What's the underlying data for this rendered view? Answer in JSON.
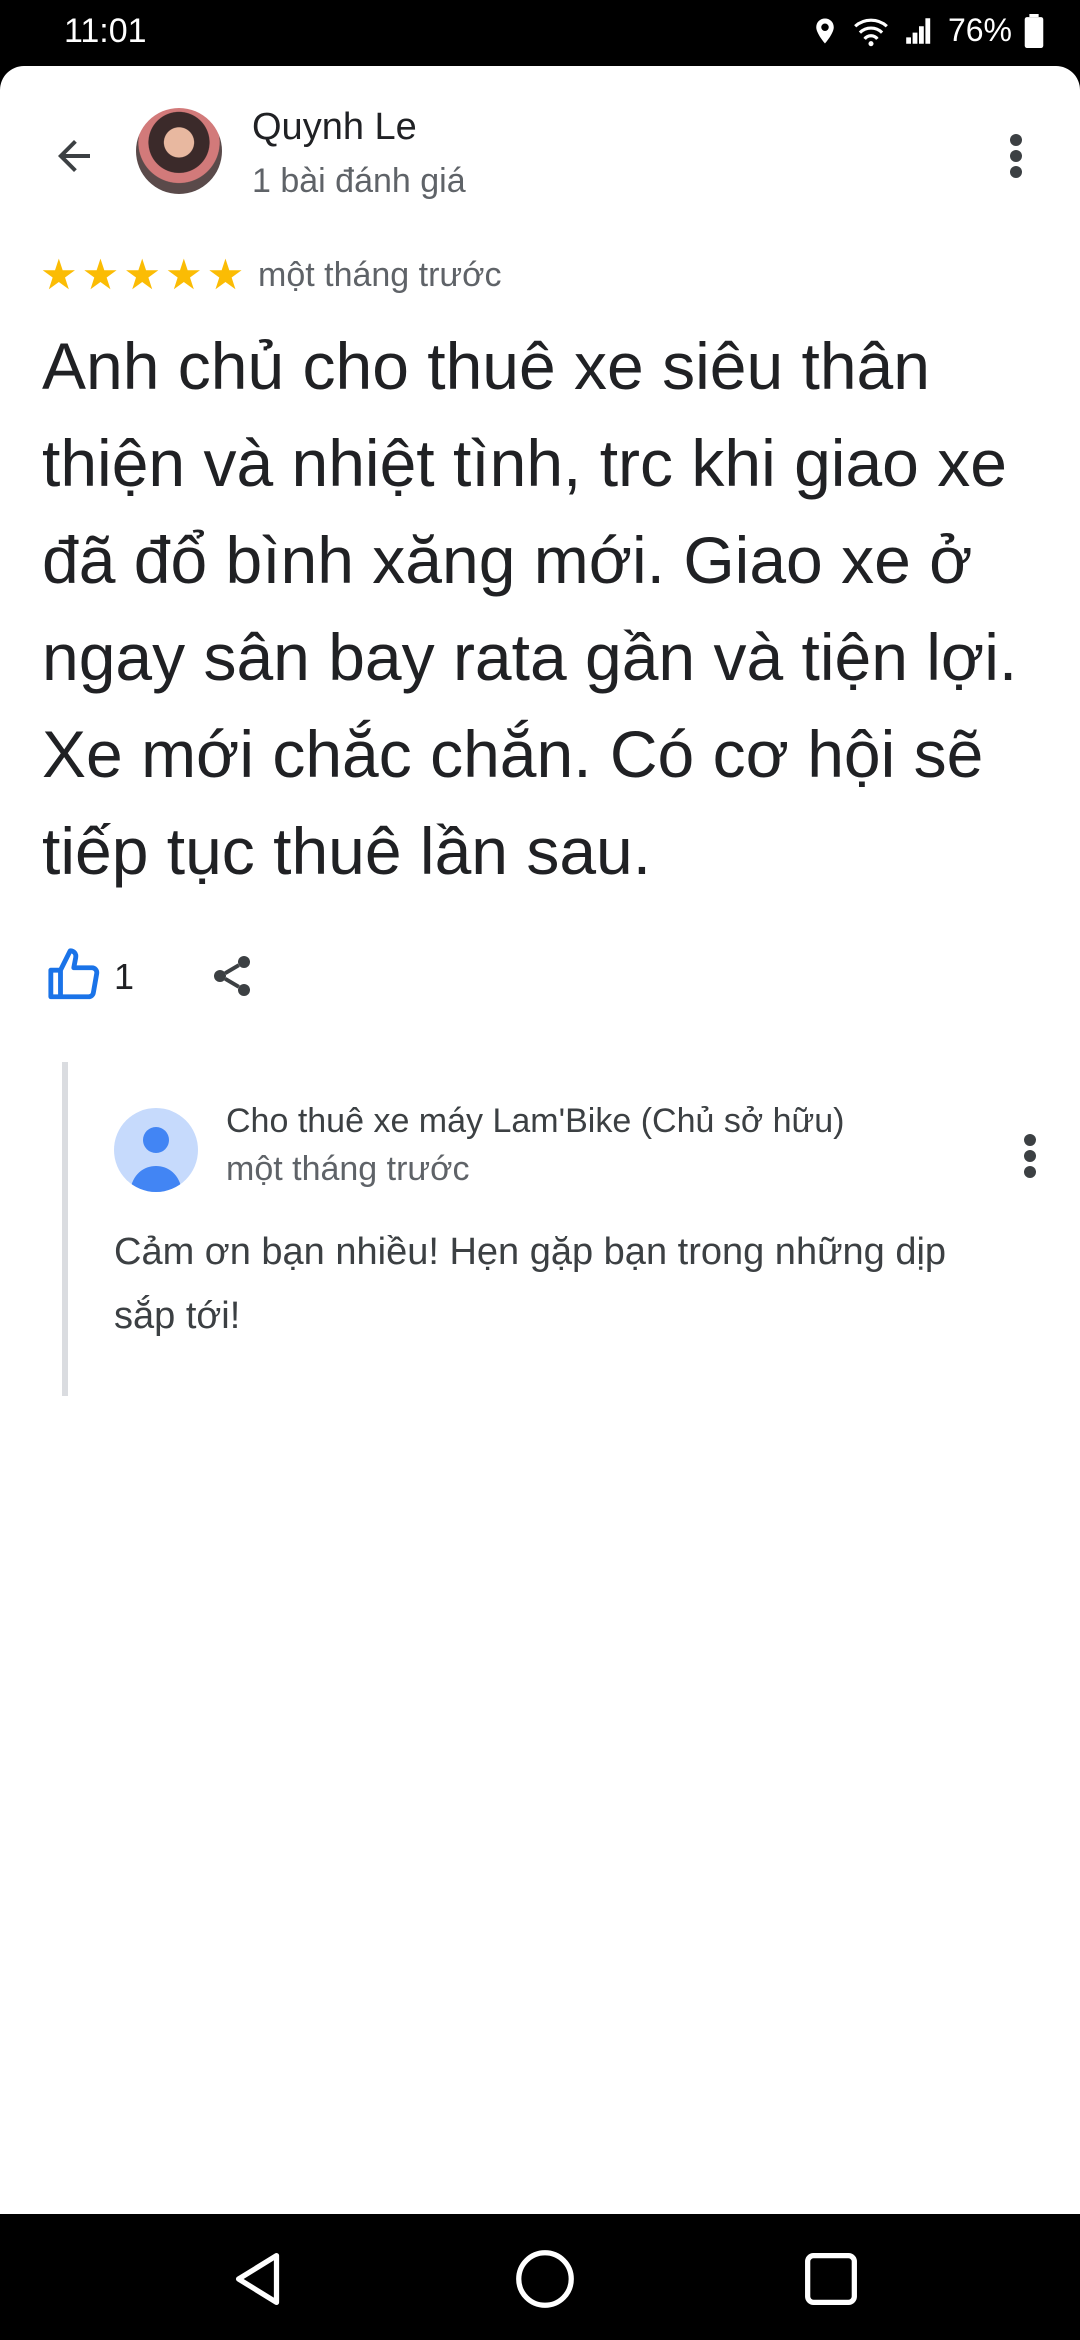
{
  "status_bar": {
    "time": "11:01",
    "battery": "76%",
    "icons": [
      "location-icon",
      "wifi-icon",
      "signal-icon",
      "battery-icon"
    ]
  },
  "reviewer": {
    "name": "Quynh Le",
    "review_count": "1 bài đánh giá"
  },
  "review": {
    "rating": 5,
    "time": "một tháng trước",
    "text": "Anh chủ cho thuê xe siêu thân thiện và nhiệt tình, trc khi giao xe đã đổ bình xăng mới. Giao xe ở ngay sân bay rata gần và tiện lợi. Xe mới chắc chắn.  Có cơ hội sẽ tiếp tục thuê lần sau.",
    "likes": "1"
  },
  "owner_reply": {
    "name": "Cho thuê xe máy Lam'Bike (Chủ sở hữu)",
    "time": "một tháng trước",
    "text": "Cảm ơn bạn nhiều! Hẹn gặp bạn trong những dịp sắp tới!"
  },
  "colors": {
    "star": "#fbbc04",
    "like_blue": "#1a73e8",
    "owner_avatar_bg": "#c6dafc",
    "owner_avatar_fg": "#4285f4"
  }
}
